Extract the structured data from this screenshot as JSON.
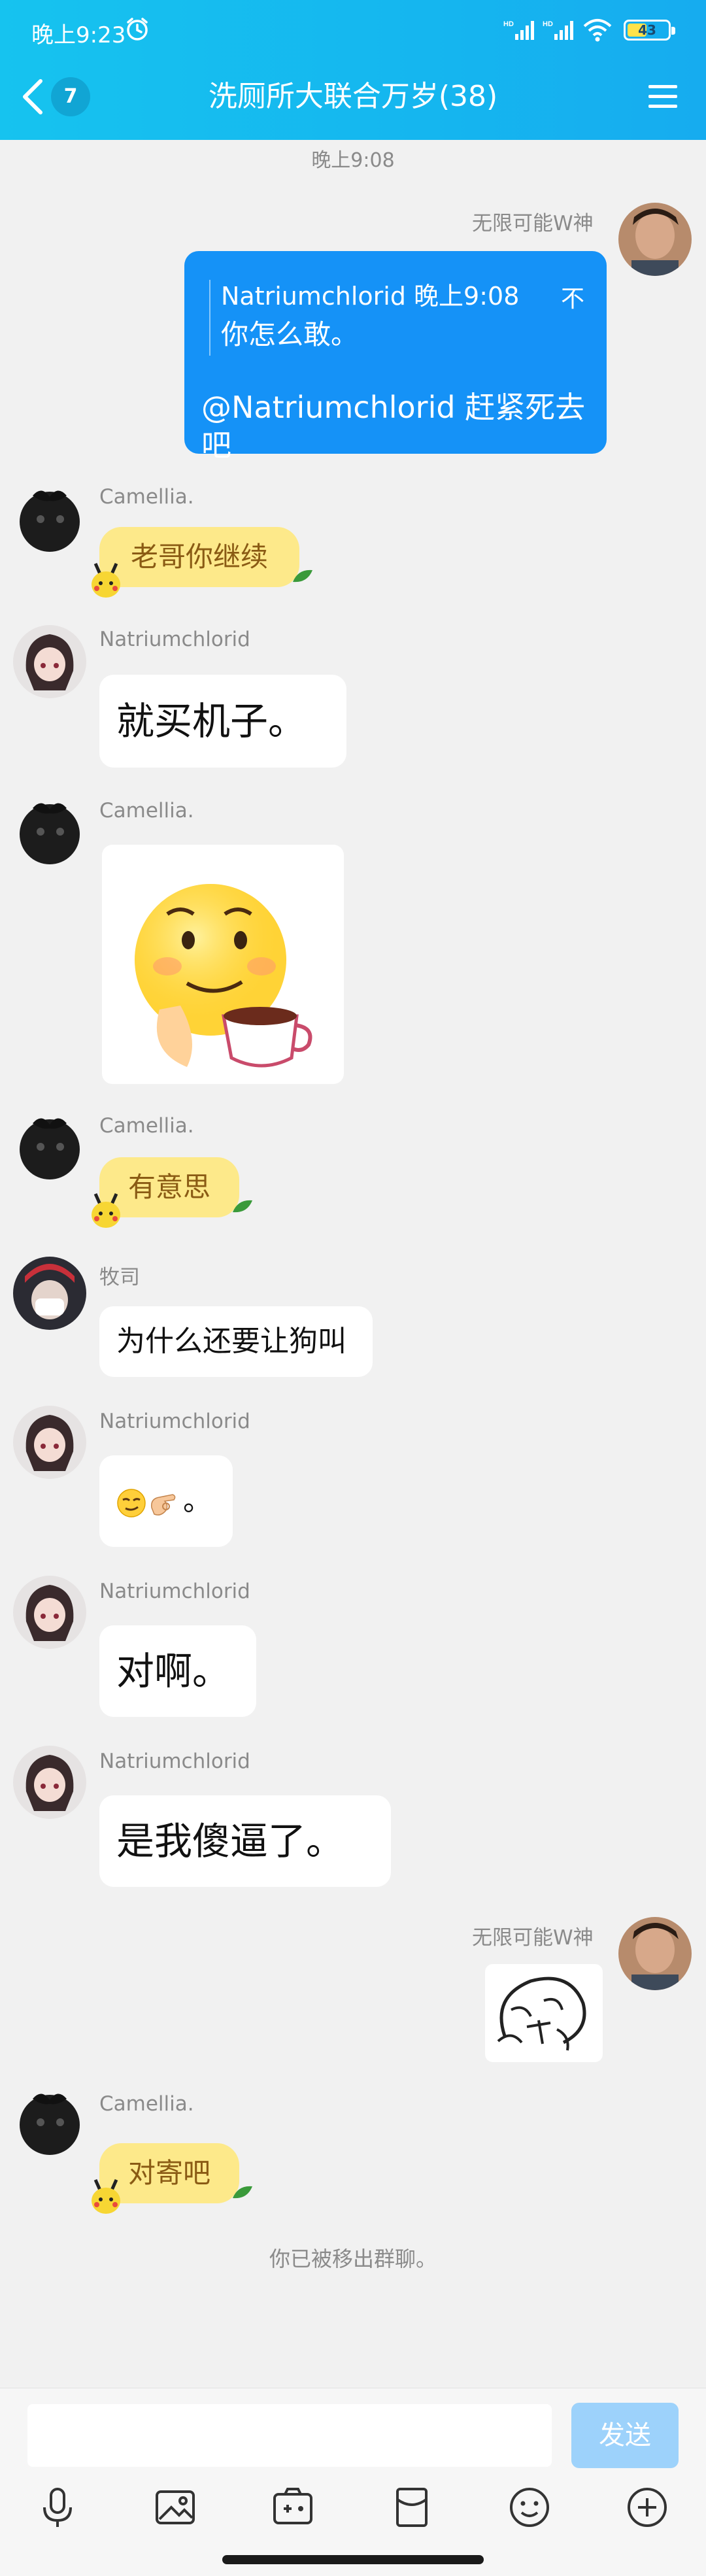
{
  "status": {
    "time": "晚上9:23",
    "battery": "43"
  },
  "header": {
    "unread_count": "7",
    "title": "洗厕所大联合万岁(38)"
  },
  "messages": {
    "timestamp": "晚上9:08",
    "m1_sender": "无限可能W神",
    "m1_reply_head": "Natriumchlorid 晚上9:08",
    "m1_reply_unread": "不",
    "m1_reply_quote": "你怎么敢。",
    "m1_text": "@Natriumchlorid 赶紧死去吧",
    "m2_sender": "Camellia.",
    "m2_text": "老哥你继续",
    "m3_sender": "Natriumchlorid",
    "m3_text": "就买机子。",
    "m4_sender": "Camellia.",
    "m5_sender": "Camellia.",
    "m5_text": "有意思",
    "m6_sender": "牧司",
    "m6_text": "为什么还要让狗叫",
    "m7_sender": "Natriumchlorid",
    "m7_text": "。",
    "m8_sender": "Natriumchlorid",
    "m8_text": "对啊。",
    "m9_sender": "Natriumchlorid",
    "m9_text": "是我傻逼了。",
    "m10_sender": "无限可能W神",
    "m11_sender": "Camellia.",
    "m11_text": "对寄吧",
    "system_note": "你已被移出群聊。"
  },
  "input": {
    "value": "",
    "send_label": "发送"
  },
  "toolbar": [
    "mic-icon",
    "image-icon",
    "camera-icon",
    "red-packet-icon",
    "emoji-icon",
    "plus-icon"
  ],
  "colors": {
    "header": "#15b6ef",
    "own_bubble": "#1592f7",
    "yellow_bubble": "#fde98a",
    "send_button": "#9dd2fb",
    "background": "#f1f1f1"
  }
}
